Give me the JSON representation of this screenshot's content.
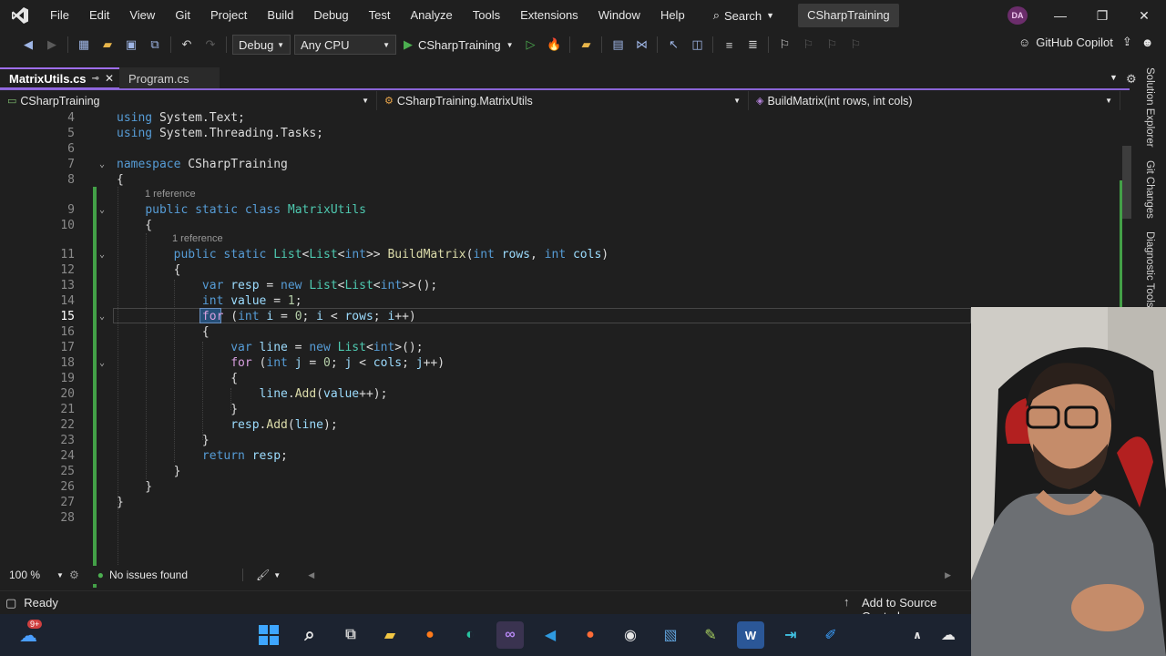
{
  "menu": {
    "items": [
      "File",
      "Edit",
      "View",
      "Git",
      "Project",
      "Build",
      "Debug",
      "Test",
      "Analyze",
      "Tools",
      "Extensions",
      "Window",
      "Help"
    ],
    "search_label": "Search",
    "solution_title": "CSharpTraining",
    "user_initials": "DA"
  },
  "toolbar": {
    "configuration": "Debug",
    "platform": "Any CPU",
    "run_target": "CSharpTraining",
    "copilot_label": "GitHub Copilot"
  },
  "tabs": [
    {
      "label": "MatrixUtils.cs",
      "active": true
    },
    {
      "label": "Program.cs",
      "active": false
    }
  ],
  "navbar": {
    "project": "CSharpTraining",
    "type": "CSharpTraining.MatrixUtils",
    "member": "BuildMatrix(int rows, int cols)"
  },
  "editor": {
    "current_line": 15,
    "codelens_class": "1 reference",
    "codelens_method": "1 reference",
    "lines": [
      {
        "n": "4",
        "code": "using System.Text;"
      },
      {
        "n": "5",
        "code": "using System.Threading.Tasks;"
      },
      {
        "n": "6",
        "code": ""
      },
      {
        "n": "7",
        "code": "namespace CSharpTraining"
      },
      {
        "n": "8",
        "code": "{"
      },
      {
        "n": "9",
        "code": "    public static class MatrixUtils"
      },
      {
        "n": "10",
        "code": "    {"
      },
      {
        "n": "11",
        "code": "        public static List<List<int>> BuildMatrix(int rows, int cols)"
      },
      {
        "n": "12",
        "code": "        {"
      },
      {
        "n": "13",
        "code": "            var resp = new List<List<int>>();"
      },
      {
        "n": "14",
        "code": "            int value = 1;"
      },
      {
        "n": "15",
        "code": "            for (int i = 0; i < rows; i++)"
      },
      {
        "n": "16",
        "code": "            {"
      },
      {
        "n": "17",
        "code": "                var line = new List<int>();"
      },
      {
        "n": "18",
        "code": "                for (int j = 0; j < cols; j++)"
      },
      {
        "n": "19",
        "code": "                {"
      },
      {
        "n": "20",
        "code": "                    line.Add(value++);"
      },
      {
        "n": "21",
        "code": "                }"
      },
      {
        "n": "22",
        "code": "                resp.Add(line);"
      },
      {
        "n": "23",
        "code": "            }"
      },
      {
        "n": "24",
        "code": "            return resp;"
      },
      {
        "n": "25",
        "code": "        }"
      },
      {
        "n": "26",
        "code": "    }"
      },
      {
        "n": "27",
        "code": "}"
      },
      {
        "n": "28",
        "code": ""
      }
    ]
  },
  "editor_status": {
    "zoom": "100 %",
    "issues": "No issues found"
  },
  "side_panels": [
    "Solution Explorer",
    "Git Changes",
    "Diagnostic Tools"
  ],
  "statusbar": {
    "state": "Ready",
    "source_control": "Add to Source Control"
  },
  "taskbar": {
    "weather_badge": "9+"
  },
  "colors": {
    "accent": "#8a64d6",
    "change_bar": "#43a047",
    "keyword": "#569cd6",
    "type": "#4ec9b0",
    "method": "#dcdcaa",
    "identifier": "#9cdcfe",
    "number": "#b5cea8",
    "control": "#d8a0df"
  }
}
